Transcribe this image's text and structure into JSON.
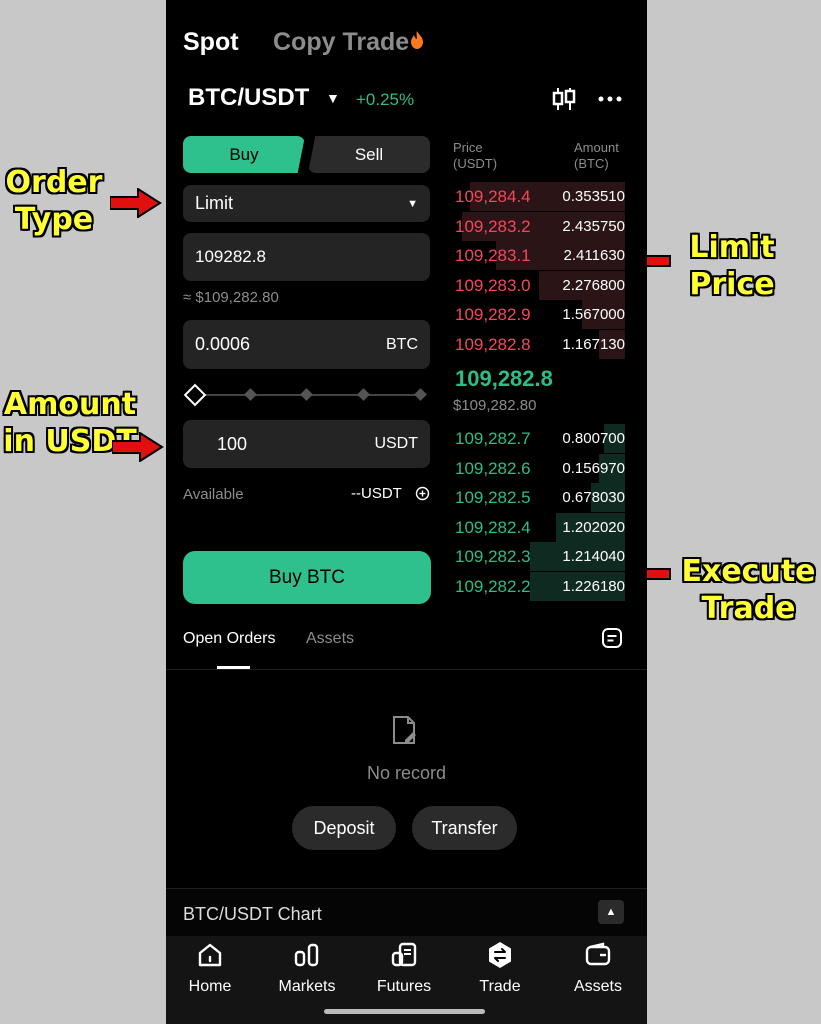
{
  "annotations": {
    "order_type": "Order Type",
    "amount_in_usdt": "Amount in USDT",
    "limit_price": "Limit Price",
    "execute_trade": "Execute Trade"
  },
  "top_tabs": {
    "spot": "Spot",
    "copy_trade": "Copy Trade"
  },
  "pair": {
    "symbol": "BTC/USDT",
    "change": "+0.25%"
  },
  "order_form": {
    "buy_label": "Buy",
    "sell_label": "Sell",
    "order_type": "Limit",
    "limit_price": "109282.8",
    "limit_price_usd": "≈ $109,282.80",
    "amount": "0.0006",
    "amount_unit": "BTC",
    "total": "100",
    "total_unit": "USDT",
    "available_label": "Available",
    "available_value": "--USDT",
    "buy_button": "Buy BTC"
  },
  "order_book": {
    "price_header": "Price",
    "price_unit": "(USDT)",
    "amount_header": "Amount",
    "amount_unit": "(BTC)",
    "asks": [
      {
        "price": "109,284.4",
        "amount": "0.353510",
        "depth": 0.9
      },
      {
        "price": "109,283.2",
        "amount": "2.435750",
        "depth": 0.95
      },
      {
        "price": "109,283.1",
        "amount": "2.411630",
        "depth": 0.75
      },
      {
        "price": "109,283.0",
        "amount": "2.276800",
        "depth": 0.5
      },
      {
        "price": "109,282.9",
        "amount": "1.567000",
        "depth": 0.25
      },
      {
        "price": "109,282.8",
        "amount": "1.167130",
        "depth": 0.15
      }
    ],
    "last_price": "109,282.8",
    "last_price_usd": "$109,282.80",
    "bids": [
      {
        "price": "109,282.7",
        "amount": "0.800700",
        "depth": 0.12
      },
      {
        "price": "109,282.6",
        "amount": "0.156970",
        "depth": 0.15
      },
      {
        "price": "109,282.5",
        "amount": "0.678030",
        "depth": 0.2
      },
      {
        "price": "109,282.4",
        "amount": "1.202020",
        "depth": 0.4
      },
      {
        "price": "109,282.3",
        "amount": "1.214040",
        "depth": 0.55
      },
      {
        "price": "109,282.2",
        "amount": "1.226180",
        "depth": 0.55
      }
    ]
  },
  "orders": {
    "tab_open": "Open Orders",
    "tab_assets": "Assets",
    "empty_text": "No record",
    "deposit": "Deposit",
    "transfer": "Transfer"
  },
  "chart_bar": {
    "label": "BTC/USDT Chart"
  },
  "nav": [
    {
      "label": "Home",
      "icon": "home-icon"
    },
    {
      "label": "Markets",
      "icon": "markets-icon"
    },
    {
      "label": "Futures",
      "icon": "futures-icon"
    },
    {
      "label": "Trade",
      "icon": "trade-icon"
    },
    {
      "label": "Assets",
      "icon": "wallet-icon"
    }
  ],
  "colors": {
    "green": "#2ec08d",
    "red": "#f6465d",
    "annotation": "#ffff33",
    "arrow": "#e01010"
  }
}
